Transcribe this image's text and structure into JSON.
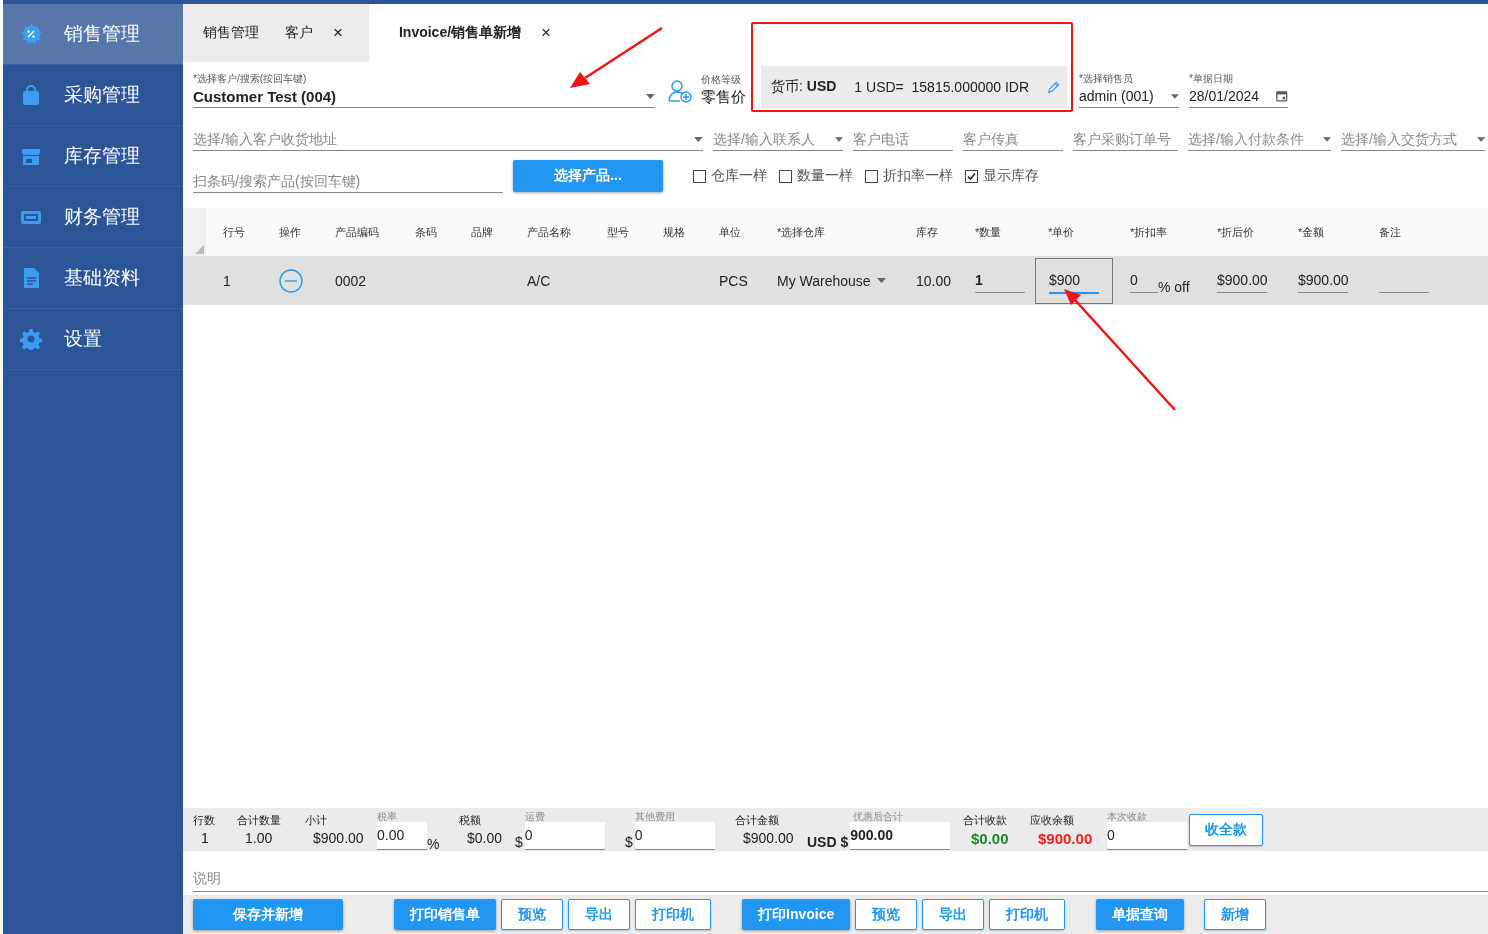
{
  "sidebar": {
    "items": [
      {
        "label": "销售管理",
        "selected": true
      },
      {
        "label": "采购管理",
        "selected": false
      },
      {
        "label": "库存管理",
        "selected": false
      },
      {
        "label": "财务管理",
        "selected": false
      },
      {
        "label": "基础资料",
        "selected": false
      },
      {
        "label": "设置",
        "selected": false
      }
    ]
  },
  "tabs": [
    {
      "label": "销售管理",
      "selected": false
    },
    {
      "label": "客户",
      "close": "×",
      "selected": false
    },
    {
      "label": "Invoice/销售单新增",
      "close": "×",
      "selected": true
    }
  ],
  "customer": {
    "label": "*选择客户/搜索(按回车键)",
    "value": "Customer Test (004)"
  },
  "price_level": {
    "label": "价格等级",
    "value": "零售价"
  },
  "currency": {
    "label": "货币:",
    "code": "USD",
    "rate": "1 USD=  15815.000000 IDR"
  },
  "salesperson": {
    "label": "*选择销售员",
    "value": "admin (001)"
  },
  "date": {
    "label": "*单据日期",
    "value": "28/01/2024"
  },
  "detail_fields": [
    {
      "placeholder": "选择/输入客户收货地址",
      "dropdown": true
    },
    {
      "placeholder": "选择/输入联系人",
      "dropdown": true
    },
    {
      "placeholder": "客户电话",
      "dropdown": false
    },
    {
      "placeholder": "客户传真",
      "dropdown": false
    },
    {
      "placeholder": "客户采购订单号",
      "dropdown": false
    },
    {
      "placeholder": "选择/输入付款条件",
      "dropdown": true
    },
    {
      "placeholder": "选择/输入交货方式",
      "dropdown": true
    }
  ],
  "scan": {
    "placeholder": "扫条码/搜索产品(按回车键)",
    "button": "选择产品..."
  },
  "options": [
    {
      "label": "仓库一样",
      "checked": false
    },
    {
      "label": "数量一样",
      "checked": false
    },
    {
      "label": "折扣率一样",
      "checked": false
    },
    {
      "label": "显示库存",
      "checked": true
    }
  ],
  "table": {
    "columns": [
      "行号",
      "操作",
      "产品编码",
      "条码",
      "品牌",
      "产品名称",
      "型号",
      "规格",
      "单位",
      "*选择仓库",
      "库存",
      "*数量",
      "*单价",
      "*折扣率",
      "*折后价",
      "*金额",
      "备注"
    ],
    "rows": [
      {
        "cells": [
          {
            "kind": "text",
            "value": "1"
          },
          {
            "kind": "remove"
          },
          {
            "kind": "text",
            "value": "0002"
          },
          {
            "kind": "empty"
          },
          {
            "kind": "empty"
          },
          {
            "kind": "text",
            "value": "A/C"
          },
          {
            "kind": "empty"
          },
          {
            "kind": "empty"
          },
          {
            "kind": "text",
            "value": "PCS"
          },
          {
            "kind": "dropdown",
            "value": "My Warehouse"
          },
          {
            "kind": "text",
            "value": "10.00"
          },
          {
            "kind": "input",
            "value": "1",
            "bold": true
          },
          {
            "kind": "focused",
            "value": "$900"
          },
          {
            "kind": "discount",
            "value": "0",
            "suffix": "% off"
          },
          {
            "kind": "input",
            "value": "$900.00",
            "bold": false
          },
          {
            "kind": "input",
            "value": "$900.00",
            "bold": false
          },
          {
            "kind": "input"
          }
        ]
      }
    ]
  },
  "summary": [
    {
      "kind": "stat",
      "label": "行数",
      "value": "1"
    },
    {
      "kind": "stat",
      "label": "合计数量",
      "value": "1.00"
    },
    {
      "kind": "stat",
      "label": "小计",
      "value": "$900.00"
    },
    {
      "kind": "input",
      "label": "税率",
      "value": "0.00",
      "suffix": "%"
    },
    {
      "kind": "stat",
      "label": "税额",
      "value": "$0.00"
    },
    {
      "kind": "input",
      "label": "运费",
      "prefix": "$",
      "value": "0"
    },
    {
      "kind": "input",
      "label": "其他费用",
      "prefix": "$",
      "value": "0"
    },
    {
      "kind": "stat",
      "label": "合计金额",
      "value": "$900.00"
    },
    {
      "kind": "input",
      "label": "优惠后合计",
      "prefix": "USD $",
      "value": "900.00",
      "bold": true
    },
    {
      "kind": "stat",
      "label": "合计收款",
      "value": "$0.00",
      "color": "#1e8a1e"
    },
    {
      "kind": "stat",
      "label": "应收余额",
      "value": "$900.00",
      "color": "#ff1a1a"
    },
    {
      "kind": "input",
      "label": "本次收款",
      "value": "0"
    },
    {
      "kind": "button",
      "label": "收全款"
    }
  ],
  "note": {
    "placeholder": "说明"
  },
  "button_groups": [
    [
      {
        "label": "保存并新增",
        "kind": "primary"
      }
    ],
    [
      {
        "label": "打印销售单",
        "kind": "primary"
      },
      {
        "label": "预览",
        "kind": "outline"
      },
      {
        "label": "导出",
        "kind": "outline"
      },
      {
        "label": "打印机",
        "kind": "outline"
      }
    ],
    [
      {
        "label": "打印Invoice",
        "kind": "primary"
      },
      {
        "label": "预览",
        "kind": "outline"
      },
      {
        "label": "导出",
        "kind": "outline"
      },
      {
        "label": "打印机",
        "kind": "outline"
      }
    ],
    [
      {
        "label": "单据查询",
        "kind": "primary"
      }
    ],
    [
      {
        "label": "新增",
        "kind": "outline"
      }
    ]
  ]
}
